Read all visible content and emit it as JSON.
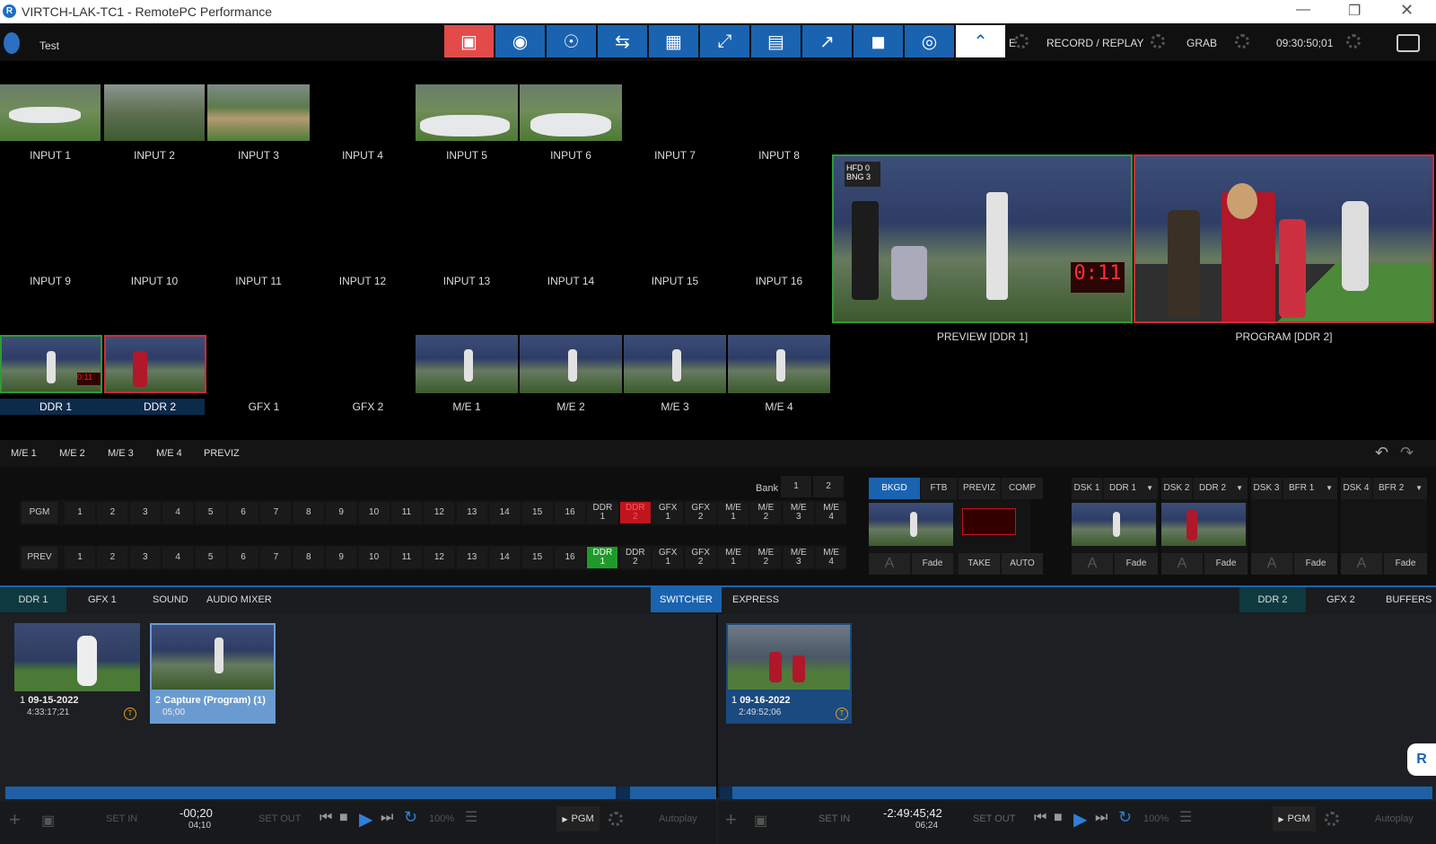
{
  "window": {
    "title": "VIRTCH-LAK-TC1 - RemotePC Performance",
    "app_icon": "R"
  },
  "topbar": {
    "session": "Test",
    "status_items": [
      "RECORD / REPLAY",
      "GRAB",
      "09:30:50;01"
    ],
    "partial_item": "E"
  },
  "inputs": {
    "row1": [
      "INPUT 1",
      "INPUT 2",
      "INPUT 3",
      "INPUT 4",
      "INPUT 5",
      "INPUT 6",
      "INPUT 7",
      "INPUT 8"
    ],
    "row2": [
      "INPUT 9",
      "INPUT 10",
      "INPUT 11",
      "INPUT 12",
      "INPUT 13",
      "INPUT 14",
      "INPUT 15",
      "INPUT 16"
    ],
    "row3": [
      "DDR 1",
      "DDR 2",
      "GFX 1",
      "GFX 2",
      "M/E 1",
      "M/E 2",
      "M/E 3",
      "M/E 4"
    ]
  },
  "monitors": {
    "preview": "PREVIEW [DDR 1]",
    "program": "PROGRAM [DDR 2]",
    "clock": "0:11",
    "score_a": "HFD 0",
    "score_b": "BNG 3"
  },
  "me_tabs": [
    "M/E 1",
    "M/E 2",
    "M/E 3",
    "M/E 4",
    "PREVIZ"
  ],
  "switcher": {
    "bank_label": "Bank",
    "banks": [
      "1",
      "2"
    ],
    "pgm_label": "PGM",
    "prev_label": "PREV",
    "buttons": [
      "1",
      "2",
      "3",
      "4",
      "5",
      "6",
      "7",
      "8",
      "9",
      "10",
      "11",
      "12",
      "13",
      "14",
      "15",
      "16",
      "DDR 1",
      "DDR 2",
      "GFX 1",
      "GFX 2",
      "M/E 1",
      "M/E 2",
      "M/E 3",
      "M/E 4"
    ],
    "pgm_active": "DDR 2",
    "prev_active": "DDR 1"
  },
  "transition": {
    "tabs": [
      "BKGD",
      "FTB",
      "PREVIZ",
      "COMP"
    ],
    "fade": "Fade",
    "take": "TAKE",
    "auto": "AUTO"
  },
  "dsk": [
    {
      "label": "DSK 1",
      "src": "DDR 1"
    },
    {
      "label": "DSK 2",
      "src": "DDR 2"
    },
    {
      "label": "DSK 3",
      "src": "BFR 1"
    },
    {
      "label": "DSK 4",
      "src": "BFR 2"
    }
  ],
  "bottom_tabs_left": [
    "DDR 1",
    "GFX 1",
    "SOUND",
    "AUDIO MIXER"
  ],
  "bottom_tabs_mid": [
    "SWITCHER",
    "EXPRESS"
  ],
  "bottom_tabs_right": [
    "DDR 2",
    "GFX 2",
    "BUFFERS"
  ],
  "clips_left": [
    {
      "num": "1",
      "name": "09-15-2022",
      "dur": "4:33:17;21"
    },
    {
      "num": "2",
      "name": "Capture (Program) (1)",
      "dur": "05;00"
    }
  ],
  "clips_right": [
    {
      "num": "1",
      "name": "09-16-2022",
      "dur": "2:49:52;06"
    }
  ],
  "transport_left": {
    "time": "-00;20",
    "sub": "04;10",
    "set_in": "SET IN",
    "set_out": "SET OUT",
    "speed": "100%",
    "out": "PGM",
    "autoplay": "Autoplay"
  },
  "transport_right": {
    "time": "-2:49:45;42",
    "sub": "06;24",
    "set_in": "SET IN",
    "set_out": "SET OUT",
    "speed": "100%",
    "out": "PGM",
    "autoplay": "Autoplay"
  },
  "colors": {
    "accent": "#1a63b0",
    "pgm_red": "#c0141e",
    "prev_green": "#1f9a2a",
    "panel": "#1d1f22"
  }
}
